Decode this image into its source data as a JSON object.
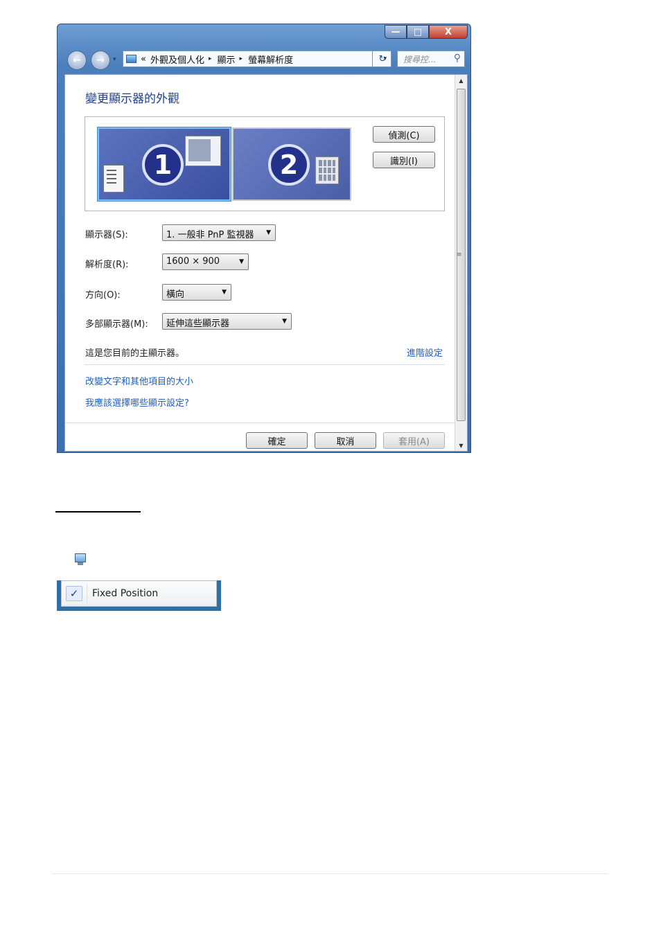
{
  "window": {
    "caption": {
      "minimize": "—",
      "maximize": "□",
      "close": "X"
    },
    "nav": {
      "back": "←",
      "forward": "→",
      "dropdown": "▾"
    },
    "address": {
      "prefix": "«",
      "crumbs": [
        "外觀及個人化",
        "顯示",
        "螢幕解析度"
      ],
      "separator": "▸",
      "dropdown": "▾",
      "refresh": "↻"
    },
    "search": {
      "placeholder": "搜尋控...",
      "icon": "magnifier-icon"
    }
  },
  "content": {
    "title": "變更顯示器的外觀",
    "monitors": [
      {
        "number": "1"
      },
      {
        "number": "2"
      }
    ],
    "buttons": {
      "detect": "偵測(C)",
      "identify": "識別(I)"
    },
    "fields": {
      "display": {
        "label": "顯示器(S):",
        "value": "1. 一般非 PnP 監視器"
      },
      "resolution": {
        "label": "解析度(R):",
        "value": "1600 × 900"
      },
      "orientation": {
        "label": "方向(O):",
        "value": "橫向"
      },
      "multiple": {
        "label": "多部顯示器(M):",
        "value": "延伸這些顯示器"
      }
    },
    "primary_info": "這是您目前的主顯示器。",
    "advanced_link": "進階設定",
    "links": [
      "改變文字和其他項目的大小",
      "我應該選擇哪些顯示設定?"
    ],
    "footer": {
      "ok": "確定",
      "cancel": "取消",
      "apply": "套用(A)"
    }
  },
  "context_menu": {
    "check": "✓",
    "item": "Fixed Position",
    "checked": true
  },
  "colors": {
    "accent": "#1e3f8a",
    "link": "#1d5fbf",
    "frame": "#4a7fbd"
  }
}
